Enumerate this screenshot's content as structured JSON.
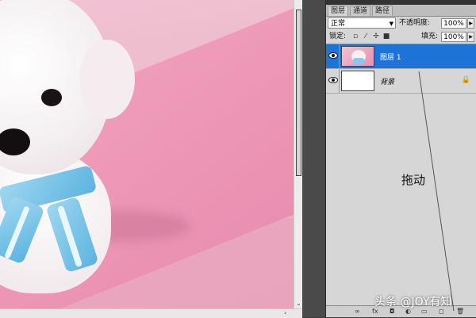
{
  "panel": {
    "tabs": [
      "图层",
      "通道",
      "路径"
    ],
    "blend_mode": "正常",
    "opacity_label": "不透明度:",
    "opacity_value": "100%",
    "lock_label": "锁定:",
    "fill_label": "填充:",
    "fill_value": "100%",
    "layers": [
      {
        "name": "图层 1",
        "selected": true,
        "thumbnail": "puppy-image"
      },
      {
        "name": "背景",
        "selected": false,
        "thumbnail": "white",
        "locked": true
      }
    ]
  },
  "annotation": {
    "drag_label": "拖动"
  },
  "watermark": "头条 @JOY有知",
  "colors": {
    "selection": "#1e73d6",
    "panel_bg": "#d6d6d6",
    "canvas_pink": "#e9a3bd"
  }
}
